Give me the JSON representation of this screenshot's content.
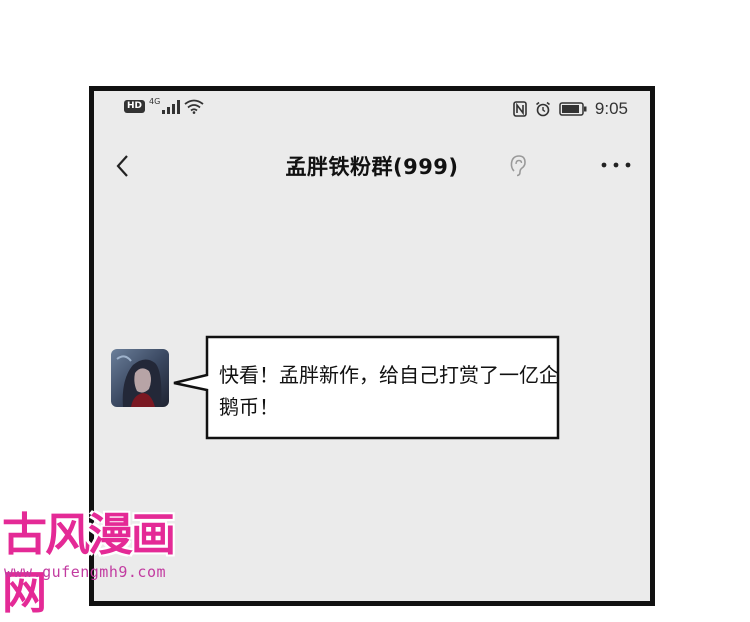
{
  "status_bar": {
    "hd": "HD",
    "network": "4G",
    "time": "9:05"
  },
  "header": {
    "title": "孟胖铁粉群(999)"
  },
  "message": {
    "text": "快看！孟胖新作，给自己打赏了一亿企鹅币！"
  },
  "watermark": {
    "title": "古风漫画网",
    "url": "www.gufengmh9.com"
  },
  "icons": [
    "signal-icon",
    "wifi-icon",
    "nfc-icon",
    "alarm-icon",
    "battery-icon",
    "back-arrow-icon",
    "ear-icon",
    "more-dots-icon"
  ],
  "colors": {
    "chat_background": "#ebebeb",
    "frame": "#111111",
    "watermark": "#e42a96"
  }
}
